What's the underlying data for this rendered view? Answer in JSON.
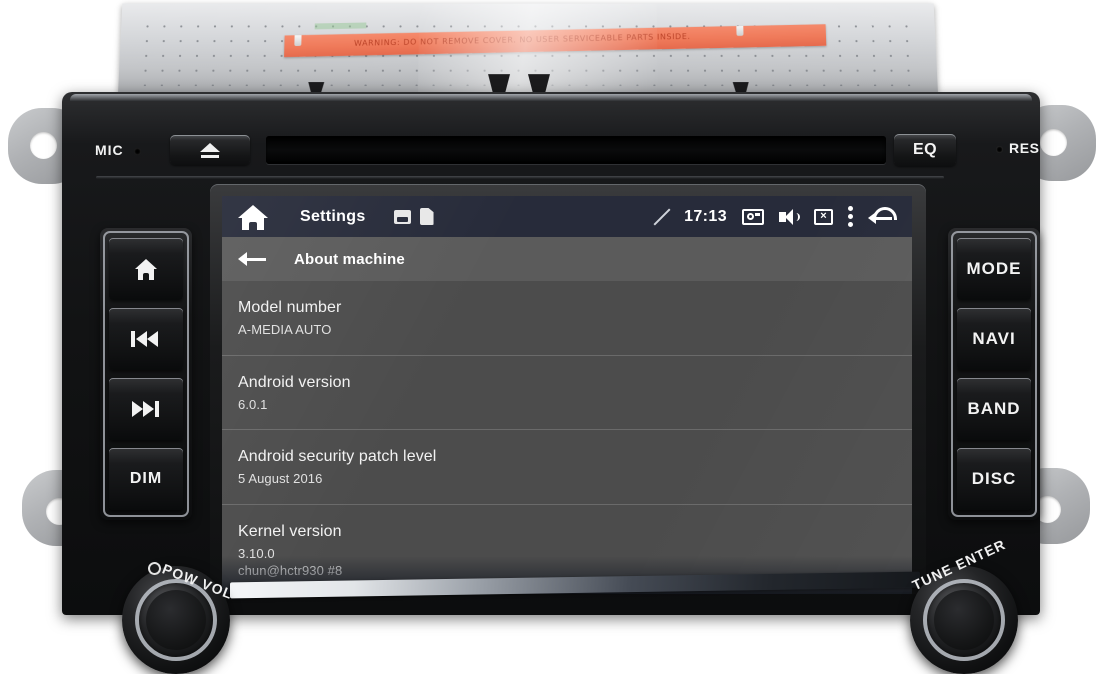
{
  "device": {
    "brand_area": {
      "mic_label": "MIC",
      "eq_label": "EQ",
      "res_label": "RES",
      "eject_icon": "eject-icon",
      "disc_slot": "disc-slot",
      "warning_label_text": "WARNING: DO NOT REMOVE COVER. NO USER SERVICEABLE PARTS INSIDE."
    },
    "left_buttons": [
      {
        "label": "",
        "icon": "home-icon",
        "name": "home"
      },
      {
        "label": "",
        "icon": "previous-track-icon",
        "name": "previous"
      },
      {
        "label": "",
        "icon": "next-track-icon",
        "name": "next"
      },
      {
        "label": "DIM",
        "icon": "",
        "name": "dim"
      }
    ],
    "right_buttons": [
      {
        "label": "MODE",
        "name": "mode"
      },
      {
        "label": "NAVI",
        "name": "navi"
      },
      {
        "label": "BAND",
        "name": "band"
      },
      {
        "label": "DISC",
        "name": "disc"
      }
    ],
    "knobs": [
      {
        "label": "POW VOL",
        "name": "power-volume"
      },
      {
        "label": "TUNE ENTER",
        "name": "tune-enter"
      }
    ]
  },
  "screen": {
    "statusbar": {
      "home_icon": "home-icon",
      "title": "Settings",
      "usb_icon": "usb-icon",
      "sd_icon": "sd-card-icon",
      "signal_icon": "no-signal-icon",
      "clock": "17:13",
      "camera_icon": "camera-icon",
      "volume_icon": "volume-icon",
      "close_screen_icon": "close-screen-icon",
      "close_screen_glyph": "×",
      "overflow_icon": "overflow-menu-icon",
      "back_icon": "back-arrow-icon"
    },
    "actionbar": {
      "back_icon": "back-arrow-icon",
      "title": "About machine"
    },
    "list": [
      {
        "title": "Model number",
        "values": [
          "A-MEDIA AUTO"
        ]
      },
      {
        "title": "Android version",
        "values": [
          "6.0.1"
        ]
      },
      {
        "title": "Android security patch level",
        "values": [
          "5 August 2016"
        ]
      },
      {
        "title": "Kernel version",
        "values": [
          "3.10.0",
          "chun@hctr930 #8"
        ]
      }
    ]
  },
  "colors": {
    "statusbar_bg": "#272b3a",
    "actionbar_bg": "#5b5b5b",
    "list_bg": "#4c4c4c",
    "divider": "#6a6a6a",
    "text_primary": "#f2f2f2",
    "text_secondary": "#e0e0e0",
    "warning_label": "#ef7a5a"
  }
}
